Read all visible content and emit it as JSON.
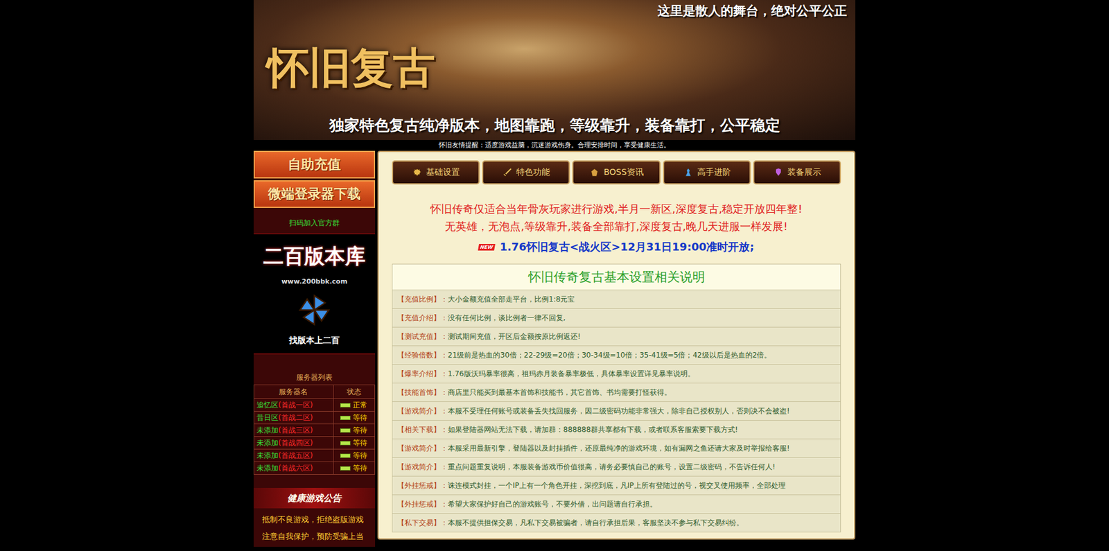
{
  "banner": {
    "slogan": "这里是散人的舞台，绝对公平公正",
    "logo": "怀旧复古",
    "subtitle": "独家特色复古纯净版本，地图靠跑，等级靠升，装备靠打，公平稳定"
  },
  "tip": "怀旧友情提醒：适度游戏益脑，沉迷游戏伤身。合理安排时间，享受健康生活。",
  "sidebar": {
    "buttons": [
      "自助充值",
      "微端登录器下载"
    ],
    "qr_caption": "扫码加入官方群",
    "ad": {
      "title": "二百版本库",
      "url": "www.200bbk.com",
      "caption": "找版本上二百"
    },
    "server_list": {
      "title": "服务器列表",
      "columns": [
        "服务器名",
        "状态"
      ],
      "rows": [
        {
          "name": "追忆区",
          "zone": "(首战一区)",
          "status": "正常"
        },
        {
          "name": "昔日区",
          "zone": "(首战二区)",
          "status": "等待"
        },
        {
          "name": "未添加",
          "zone": "(首战三区)",
          "status": "等待"
        },
        {
          "name": "未添加",
          "zone": "(首战四区)",
          "status": "等待"
        },
        {
          "name": "未添加",
          "zone": "(首战五区)",
          "status": "等待"
        },
        {
          "name": "未添加",
          "zone": "(首战六区)",
          "status": "等待"
        }
      ]
    },
    "notice": {
      "title": "健康游戏公告",
      "lines": [
        "抵制不良游戏，拒绝盗版游戏",
        "注意自我保护，预防受骗上当"
      ]
    }
  },
  "nav": [
    "基础设置",
    "特色功能",
    "BOSS资讯",
    "高手进阶",
    "装备展示"
  ],
  "intro": [
    "怀旧传奇仅适合当年骨灰玩家进行游戏,半月一新区,深度复古,稳定开放四年整!",
    "无英雄，无泡点,等级靠升,装备全部靠打,深度复古,晚几天进服一样发展!"
  ],
  "announcement": {
    "badge": "NEW",
    "text": "1.76怀旧复古<战火区>12月31日19:00准时开放;"
  },
  "settings": {
    "title": "怀旧传奇复古基本设置相关说明",
    "rows": [
      {
        "label": "【充值比例】：",
        "text": "大小金额充值全部走平台，比例1:8元宝"
      },
      {
        "label": "【充值介绍】：",
        "text": "没有任何比例，谈比例者一律不回复,"
      },
      {
        "label": "【测试充值】：",
        "text": "测试期间充值，开区后金额按原比例返还!"
      },
      {
        "label": "【经验倍数】：",
        "text": "21级前是热血的30倍；22-29级=20倍；30-34级=10倍；35-41级=5倍；42级以后是热血的2倍。"
      },
      {
        "label": "【爆率介绍】：",
        "text": "1.76版沃玛暴率很高，祖玛赤月装备暴率极低，具体暴率设置详见暴率说明。"
      },
      {
        "label": "【技能首饰】：",
        "text": "商店里只能买到最基本首饰和技能书，其它首饰、书均需要打怪获得。"
      },
      {
        "label": "【游戏简介】：",
        "text": "本服不受理任何账号或装备丢失找回服务，因二级密码功能非常强大，除非自己授权别人，否则决不会被盗!"
      },
      {
        "label": "【相关下载】：",
        "text": "如果登陆器网站无法下载，请加群：888888群共享都有下载，或者联系客服索要下载方式!"
      },
      {
        "label": "【游戏简介】：",
        "text": "本服采用最新引擎，登陆器以及封挂插件，还原最纯净的游戏环境，如有漏网之鱼还请大家及时举报给客服!"
      },
      {
        "label": "【游戏简介】：",
        "text": "重点问题重复说明，本服装备游戏币价值很高，请务必要慎自己的账号，设置二级密码，不告诉任何人!"
      },
      {
        "label": "【外挂惩戒】：",
        "text": "诛连模式封挂，一个IP上有一个角色开挂，深挖到底，凡IP上所有登陆过的号，视交叉使用频率，全部处理"
      },
      {
        "label": "【外挂惩戒】：",
        "text": "希望大家保护好自己的游戏账号，不要外借，出问题请自行承担。"
      },
      {
        "label": "【私下交易】：",
        "text": "本服不提供担保交易，凡私下交易被骗者，请自行承担后果，客服坚决不参与私下交易纠纷。"
      }
    ]
  }
}
